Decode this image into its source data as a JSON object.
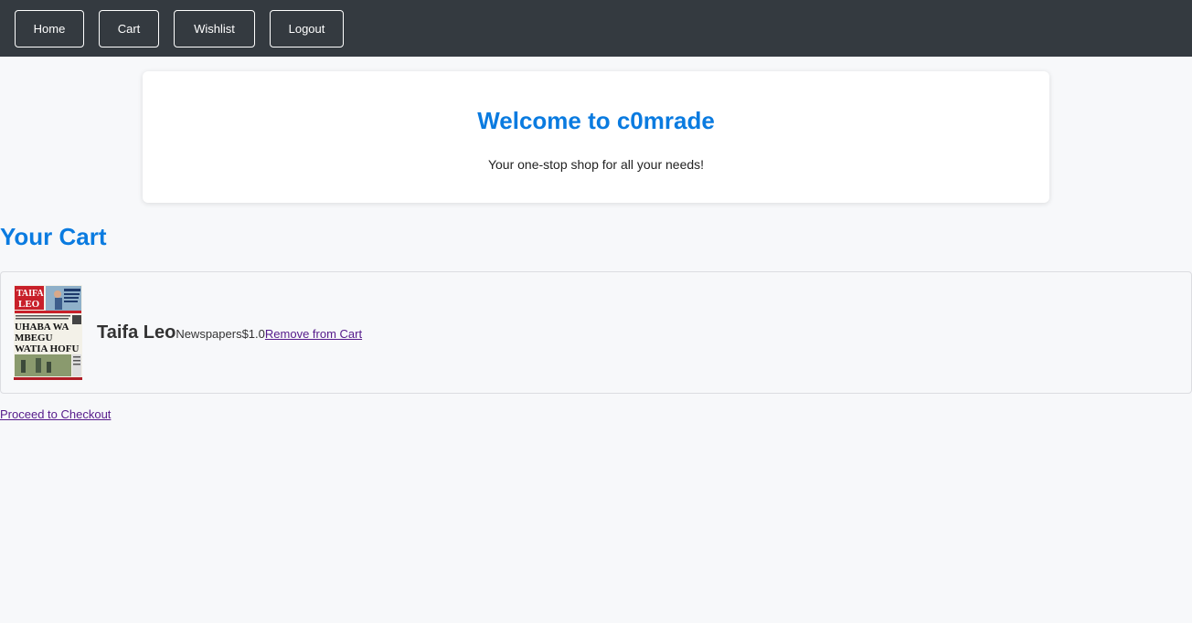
{
  "nav": {
    "home": "Home",
    "cart": "Cart",
    "wishlist": "Wishlist",
    "logout": "Logout"
  },
  "welcome": {
    "title": "Welcome to c0mrade",
    "subtitle": "Your one-stop shop for all your needs!"
  },
  "cart": {
    "heading": "Your Cart",
    "items": [
      {
        "name": "Taifa Leo",
        "category": "Newspapers",
        "price": "$1.0",
        "remove_label": "Remove from Cart",
        "thumbnail": {
          "masthead": "TAIFA LEO",
          "headline_lines": [
            "UHABA WA",
            "MBEGU",
            "WATIA HOFU"
          ]
        }
      }
    ],
    "checkout_label": "Proceed to Checkout"
  },
  "colors": {
    "navbar_bg": "#343a40",
    "accent_blue": "#0a7be0",
    "link_visited": "#551a8b",
    "page_bg": "#f7f8fa"
  }
}
